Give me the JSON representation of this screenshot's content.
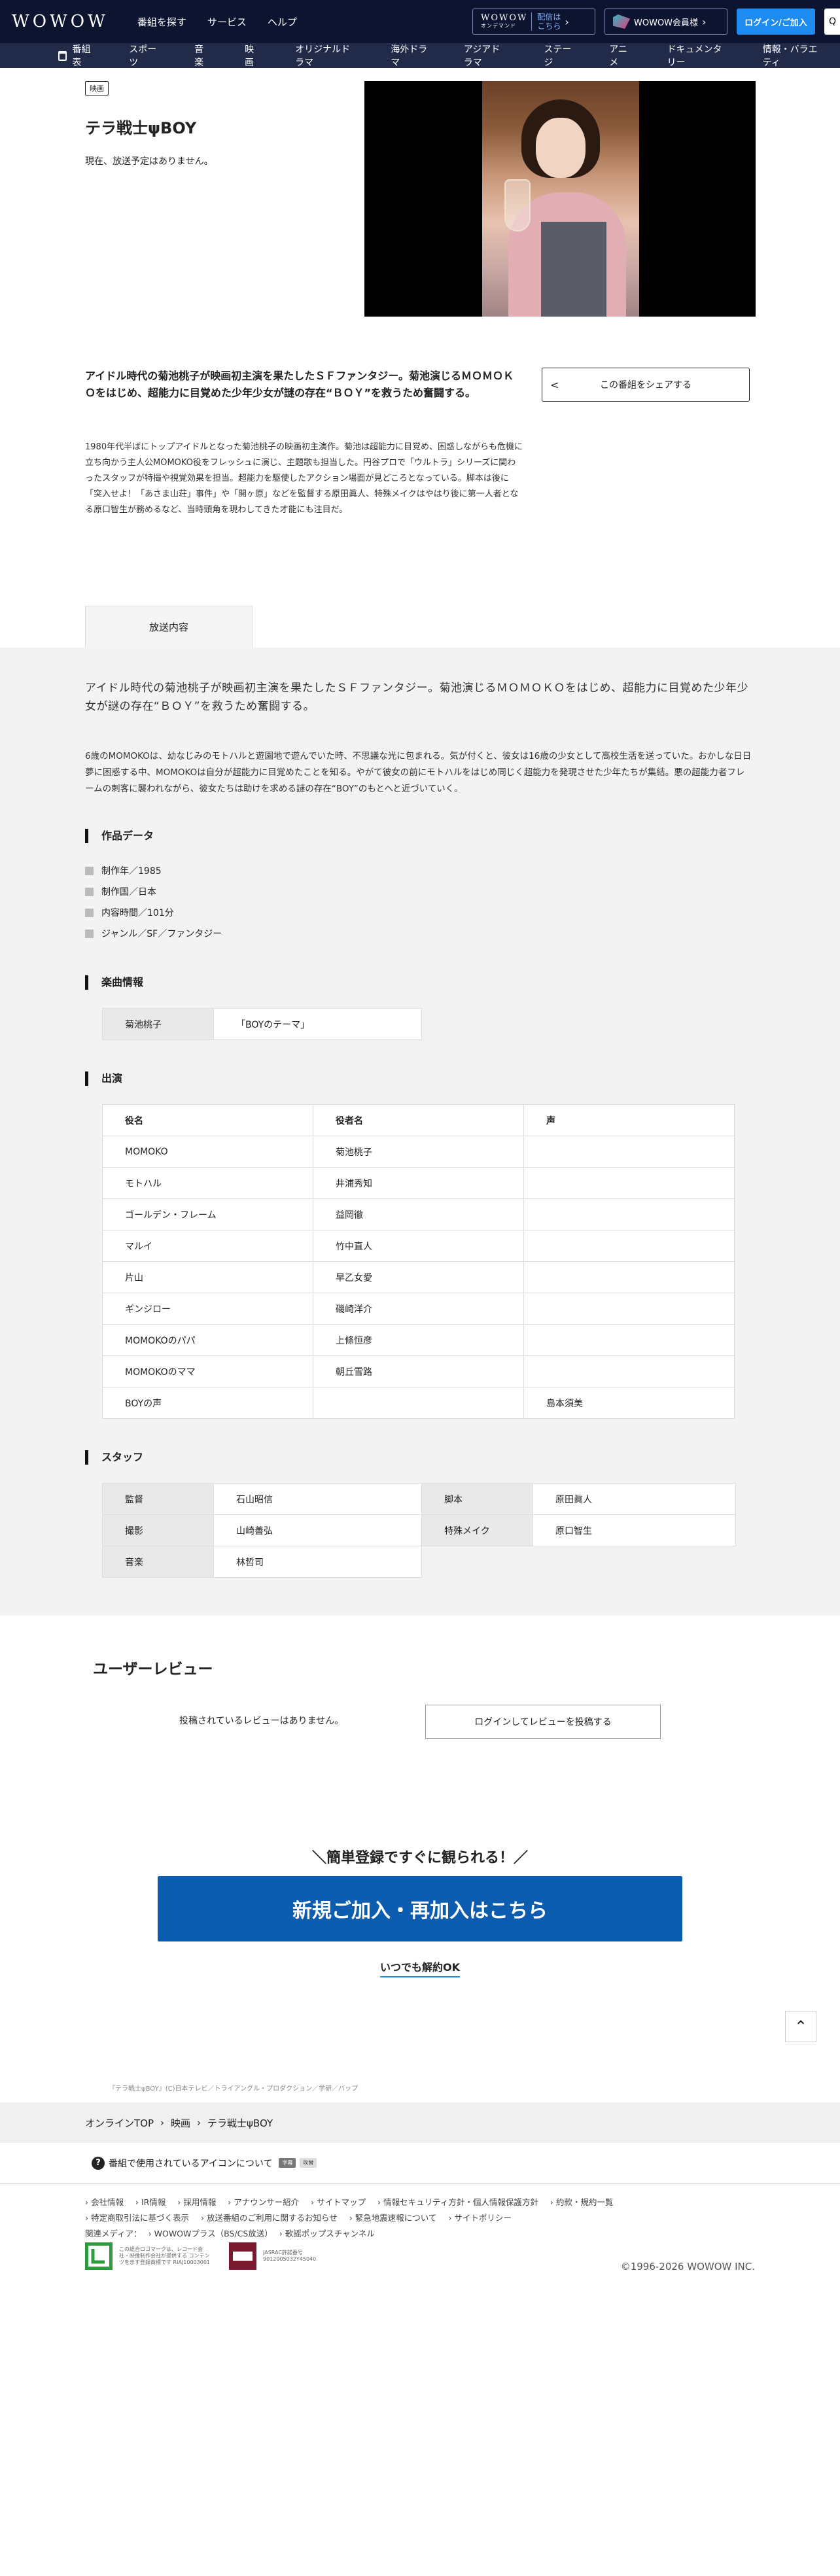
{
  "header": {
    "logo": "WOWOW",
    "nav": [
      "番組を探す",
      "サービス",
      "ヘルプ"
    ],
    "ondemand_logo": "WOWOW",
    "ondemand_sub": "オンデマンド",
    "ondemand_text1": "配信は",
    "ondemand_text2": "こちら",
    "kaiin_label": "WOWOW会員様",
    "login_label": "ログイン/ご加入",
    "icons": {
      "search": "search-icon",
      "arrow": "chevron-right-icon"
    }
  },
  "gnav": [
    "番組表",
    "スポーツ",
    "音楽",
    "映画",
    "オリジナルドラマ",
    "海外ドラマ",
    "アジアドラマ",
    "ステージ",
    "アニメ",
    "ドキュメンタリー",
    "情報・バラエティ"
  ],
  "program": {
    "genre": "映画",
    "title": "テラ戦士ψBOY",
    "no_air": "現在、放送予定はありません。",
    "summary": "アイドル時代の菊池桃子が映画初主演を果たしたＳＦファンタジー。菊池演じるＭＯＭＯＫＯをはじめ、超能力に目覚めた少年少女が謎の存在“ＢＯＹ”を救うため奮闘する。",
    "share_label": "この番組をシェアする",
    "description": "1980年代半ばにトップアイドルとなった菊池桃子の映画初主演作。菊池は超能力に目覚め、困惑しながらも危機に立ち向かう主人公MOMOKO役をフレッシュに演じ、主題歌も担当した。円谷プロで「ウルトラ」シリーズに関わったスタッフが特撮や視覚効果を担当。超能力を駆使したアクション場面が見どころとなっている。脚本は後に「突入せよ！「あさま山荘」事件」や「開ヶ原」などを監督する原田眞人、特殊メイクはやはり後に第一人者となる原口智生が務めるなど、当時頭角を現わしてきた才能にも注目だ。"
  },
  "tab_label": "放送内容",
  "content": {
    "lead": "アイドル時代の菊池桃子が映画初主演を果たしたＳＦファンタジー。菊池演じるＭＯＭＯＫＯをはじめ、超能力に目覚めた少年少女が謎の存在“ＢＯＹ”を救うため奮闘する。",
    "story": "6歳のMOMOKOは、幼なじみのモトハルと遊園地で遊んでいた時、不思議な光に包まれる。気が付くと、彼女は16歳の少女として高校生活を送っていた。おかしな日日夢に困惑する中、MOMOKOは自分が超能力に目覚めたことを知る。やがて彼女の前にモトハルをはじめ同じく超能力を発現させた少年たちが集結。悪の超能力者フレームの刺客に襲われながら、彼女たちは助けを求める謎の存在“BOY”のもとへと近づいていく。",
    "data_title": "作品データ",
    "data": [
      "制作年／1985",
      "制作国／日本",
      "内容時間／101分",
      "ジャンル／SF／ファンタジー"
    ],
    "music_title": "楽曲情報",
    "music": {
      "artist": "菊池桃子",
      "song": "「BOYのテーマ」"
    },
    "cast_title": "出演",
    "cast_headers": [
      "役名",
      "役者名",
      "声"
    ],
    "cast": [
      [
        "MOMOKO",
        "菊池桃子",
        ""
      ],
      [
        "モトハル",
        "井浦秀知",
        ""
      ],
      [
        "ゴールデン・フレーム",
        "益岡徹",
        ""
      ],
      [
        "マルイ",
        "竹中直人",
        ""
      ],
      [
        "片山",
        "早乙女愛",
        ""
      ],
      [
        "ギンジロー",
        "磯崎洋介",
        ""
      ],
      [
        "MOMOKOのパパ",
        "上條恒彦",
        ""
      ],
      [
        "MOMOKOのママ",
        "朝丘雪路",
        ""
      ],
      [
        "BOYの声",
        "",
        "島本須美"
      ]
    ],
    "staff_title": "スタッフ",
    "staff": [
      [
        "監督",
        "石山昭信",
        "脚本",
        "原田眞人"
      ],
      [
        "撮影",
        "山崎善弘",
        "特殊メイク",
        "原口智生"
      ],
      [
        "音楽",
        "林哲司",
        "",
        ""
      ]
    ]
  },
  "review": {
    "title": "ユーザーレビュー",
    "none": "投稿されているレビューはありません。",
    "button": "ログインしてレビューを投稿する"
  },
  "cta": {
    "lead": "＼簡単登録ですぐに観られる！／",
    "button": "新規ご加入・再加入はこちら",
    "sub": "いつでも解約OK",
    "copyright": "『テラ戦士ψBOY』(C)日本テレビ／トライアングル・プロダクション／学研／バップ"
  },
  "breadcrumb": [
    "オンラインTOP",
    "映画",
    "テラ戦士ψBOY"
  ],
  "icon_note": "番組で使用されているアイコンについて",
  "icon_tags": [
    "字幕",
    "吹替"
  ],
  "footer": {
    "row1": [
      "会社情報",
      "IR情報",
      "採用情報",
      "アナウンサー紹介",
      "サイトマップ",
      "情報セキュリティ方針・個人情報保護方針",
      "約款・規約一覧"
    ],
    "row2": [
      "特定商取引法に基づく表示",
      "放送番組のご利用に関するお知らせ",
      "緊急地震速報について",
      "サイトポリシー"
    ],
    "row3_label": "関連メディア：",
    "row3": [
      "WOWOWプラス（BS/CS放送）",
      "歌謡ポップスチャンネル"
    ],
    "badge1": "この総合ロゴマークは、レコード会社・映像制作会社が提供する コンテンツを示す登録商標です RIAJ10003001",
    "badge2": "JASRAC許諾番号 9012005032Y45040",
    "copyright": "©1996-2026 WOWOW INC."
  }
}
